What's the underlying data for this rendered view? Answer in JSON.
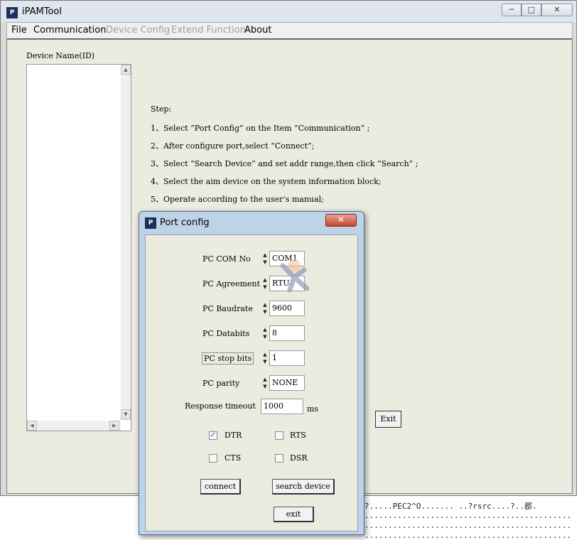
{
  "background": {
    "line1": "?.....PEC2^O....... ..?rsrc....?..郡.",
    "line2": "............................................",
    "line3": "............................................",
    "line4": "............................................",
    "line5": "............................................"
  },
  "window": {
    "title": "iPAMTool",
    "minimize": "─",
    "maximize": "□",
    "close": "✕",
    "icon": "app-icon"
  },
  "menu": {
    "file": "File",
    "communication": "Communication",
    "device_config": "Device Config",
    "extend_function": "Extend Function",
    "about": "About"
  },
  "main": {
    "device_label": "Device Name(ID)",
    "steps": [
      "Step:",
      "1、Select “Port Config” on the Item “Communication” ;",
      "2、After configure port,select “Connect”;",
      "3、Select “Search Device” and set addr range,then click “Search” ;",
      "4、Select the aim device on the system information block;",
      "5、Operate according to the user’s manual;"
    ],
    "exit_button": "Exit"
  },
  "dialog": {
    "title": "Port config",
    "close": "✕",
    "com_label": "PC COM No",
    "com_value": "COM1",
    "agreement_label": "PC Agreement",
    "agreement_value": "RTU",
    "baud_label": "PC Baudrate",
    "baud_value": "9600",
    "databits_label": "PC Databits",
    "databits_value": "8",
    "stopbits_label": "PC stop bits",
    "stopbits_value": "1",
    "parity_label": "PC parity",
    "parity_value": "NONE",
    "timeout_label": "Response timeout",
    "timeout_value": "1000",
    "timeout_unit": "ms",
    "dtr_label": "DTR",
    "dtr_checked": true,
    "rts_label": "RTS",
    "rts_checked": false,
    "cts_label": "CTS",
    "cts_checked": false,
    "dsr_label": "DSR",
    "dsr_checked": false,
    "connect_button": "connect",
    "search_button": "search device",
    "exit_button": "exit",
    "check_mark": "✓"
  }
}
